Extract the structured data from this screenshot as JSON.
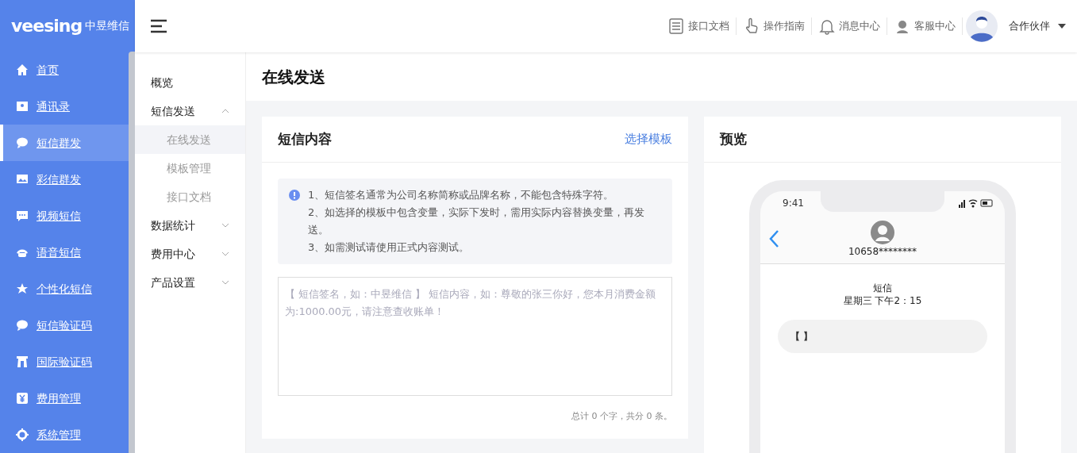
{
  "logo": {
    "brand": "veesing",
    "name": "中昱维信"
  },
  "sidebar": {
    "items": [
      {
        "label": "首页",
        "selected": false
      },
      {
        "label": "通讯录",
        "selected": false
      },
      {
        "label": "短信群发",
        "selected": true
      },
      {
        "label": "彩信群发",
        "selected": false
      },
      {
        "label": "视频短信",
        "selected": false
      },
      {
        "label": "语音短信",
        "selected": false
      },
      {
        "label": "个性化短信",
        "selected": false
      },
      {
        "label": "短信验证码",
        "selected": false
      },
      {
        "label": "国际验证码",
        "selected": false
      },
      {
        "label": "费用管理",
        "selected": false
      },
      {
        "label": "系统管理",
        "selected": false
      }
    ]
  },
  "header": {
    "links": [
      {
        "label": "接口文档"
      },
      {
        "label": "操作指南"
      },
      {
        "label": "消息中心"
      },
      {
        "label": "客服中心"
      }
    ],
    "user": {
      "name": "合作伙伴"
    }
  },
  "submenu": {
    "items": [
      {
        "kind": "link",
        "label": "概览"
      },
      {
        "kind": "group",
        "label": "短信发送",
        "expanded": true,
        "children": [
          {
            "label": "在线发送",
            "selected": true
          },
          {
            "label": "模板管理",
            "selected": false
          },
          {
            "label": "接口文档",
            "selected": false
          }
        ]
      },
      {
        "kind": "group",
        "label": "数据统计",
        "expanded": false
      },
      {
        "kind": "group",
        "label": "费用中心",
        "expanded": false
      },
      {
        "kind": "group",
        "label": "产品设置",
        "expanded": false
      }
    ]
  },
  "page_title": "在线发送",
  "compose": {
    "title": "短信内容",
    "template_link": "选择模板",
    "notes": [
      "1、短信签名通常为公司名称简称或品牌名称，不能包含特殊字符。",
      "2、如选择的模板中包含变量，实际下发时，需用实际内容替换变量，再发送。",
      "3、如需测试请使用正式内容测试。"
    ],
    "message": {
      "placeholder": "【 短信签名，如：中昱维信 】 短信内容，如：尊敬的张三你好，您本月消费金额为:1000.00元，请注意查收账单！"
    },
    "counter": "总计 0 个字，共分 0 条。"
  },
  "preview": {
    "title": "预览",
    "phone": {
      "time": "9:41",
      "sender": "10658********",
      "label": "短信",
      "timestamp": "星期三 下午2：15",
      "bubble": "【 】"
    }
  }
}
